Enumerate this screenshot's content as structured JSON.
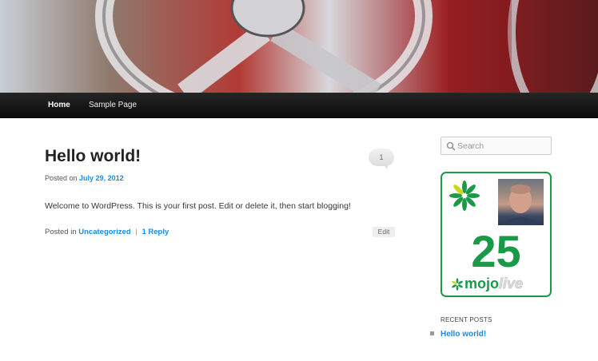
{
  "nav": {
    "items": [
      {
        "label": "Home",
        "active": true
      },
      {
        "label": "Sample Page",
        "active": false
      }
    ]
  },
  "post": {
    "title": "Hello world!",
    "comment_count": "1",
    "posted_on_label": "Posted on",
    "date": "July 29, 2012",
    "body": "Welcome to WordPress. This is your first post. Edit or delete it, then start blogging!",
    "posted_in_label": "Posted in",
    "category": "Uncategorized",
    "separator": "|",
    "reply_link": "1 Reply",
    "edit_label": "Edit"
  },
  "sidebar": {
    "search_placeholder": "Search",
    "badge": {
      "count": "25",
      "brand_mojo": "mojo",
      "brand_live": "live",
      "accent_color": "#1a9a48"
    },
    "recent_posts_title": "RECENT POSTS",
    "recent_posts": [
      "Hello world!"
    ]
  },
  "colors": {
    "link": "#1b8be0",
    "nav_bg": "#1a1a1a"
  }
}
